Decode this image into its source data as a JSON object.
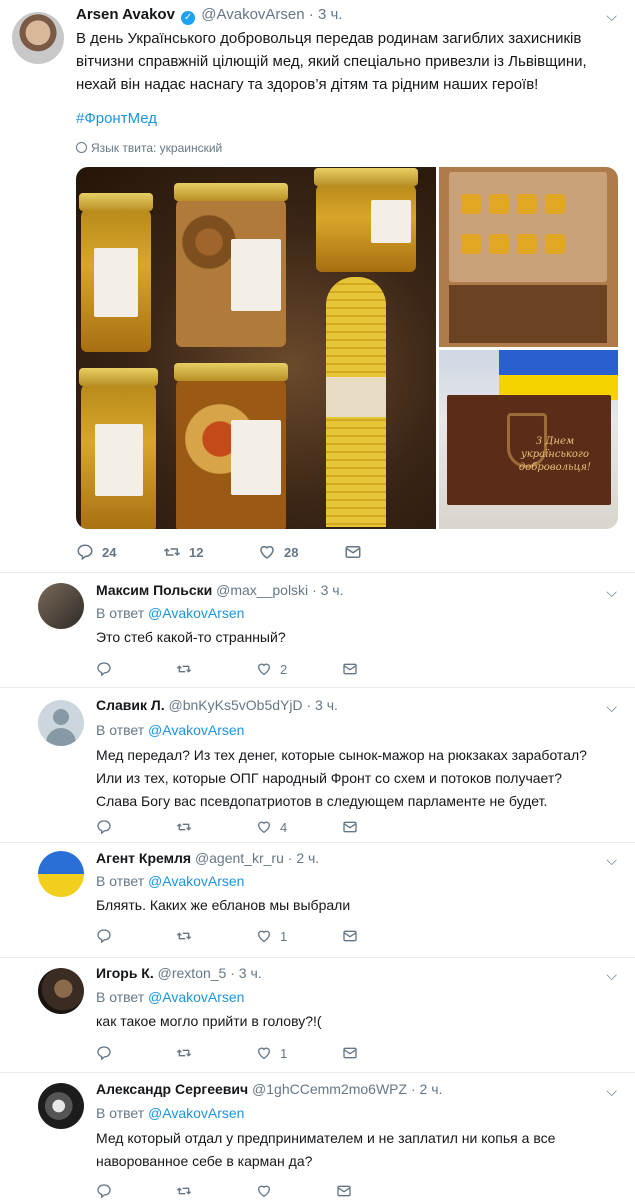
{
  "main_tweet": {
    "name": "Arsen Avakov",
    "handle": "@AvakovArsen",
    "dot": "·",
    "time": "3 ч.",
    "text_lines": [
      "В день Українського добровольця передав родинам загиблих захисників",
      "вітчизни справжній цілющій мед, який спеціально привезли із Львівщини,",
      "нехай він надає наснагу та здоров’я дітям та рідним наших героїв!"
    ],
    "hashtag": "#ФронтМед",
    "language_label": "Язык твита: украинский",
    "gift_box_text": "З Днем українського добровольця!",
    "counts": {
      "replies": "24",
      "retweets": "12",
      "likes": "28"
    }
  },
  "replies": [
    {
      "name": "Максим Польски",
      "handle": "@max__polski",
      "time": "3 ч.",
      "replying_prefix": "В ответ",
      "replying_to": "@AvakovArsen",
      "lines": [
        "Это стеб какой-то странный?"
      ],
      "counts": {
        "replies": "",
        "retweets": "",
        "likes": "2"
      }
    },
    {
      "name": "Славик Л.",
      "handle": "@bnKyKs5vOb5dYjD",
      "time": "3 ч.",
      "replying_prefix": "В ответ",
      "replying_to": "@AvakovArsen",
      "lines": [
        "Мед передал? Из тех денег, которые сынок-мажор на рюкзаках заработал?",
        "Или из тех, которые ОПГ народный Фронт со схем и потоков получает?",
        "Слава Богу вас псевдопатриотов в следующем парламенте не будет."
      ],
      "counts": {
        "replies": "",
        "retweets": "",
        "likes": "4"
      }
    },
    {
      "name": "Агент Кремля",
      "handle": "@agent_kr_ru",
      "time": "2 ч.",
      "replying_prefix": "В ответ",
      "replying_to": "@AvakovArsen",
      "lines": [
        "Бляять. Каких же ебланов мы выбрали"
      ],
      "counts": {
        "replies": "",
        "retweets": "",
        "likes": "1"
      }
    },
    {
      "name": "Игорь К.",
      "handle": "@rexton_5",
      "time": "3 ч.",
      "replying_prefix": "В ответ",
      "replying_to": "@AvakovArsen",
      "lines": [
        "как такое могло прийти в голову?!("
      ],
      "counts": {
        "replies": "",
        "retweets": "",
        "likes": "1"
      }
    },
    {
      "name": "Александр Сергеевич",
      "handle": "@1ghCCemm2mo6WPZ",
      "time": "2 ч.",
      "replying_prefix": "В ответ",
      "replying_to": "@AvakovArsen",
      "lines": [
        "Мед который отдал у предпринимателем и не заплатил ни копья а все",
        "наворованное себе в карман да?"
      ],
      "counts": {
        "replies": "",
        "retweets": "",
        "likes": ""
      }
    }
  ],
  "colors": {
    "link": "#1b95e0",
    "muted": "#657786",
    "text": "#14171a",
    "verified": "#1da1f2"
  },
  "icons": {
    "verified": "verified-badge-icon",
    "chevron": "chevron-down-icon",
    "globe": "globe-icon",
    "reply": "reply-icon",
    "retweet": "retweet-icon",
    "like": "heart-icon",
    "dm": "envelope-icon"
  }
}
